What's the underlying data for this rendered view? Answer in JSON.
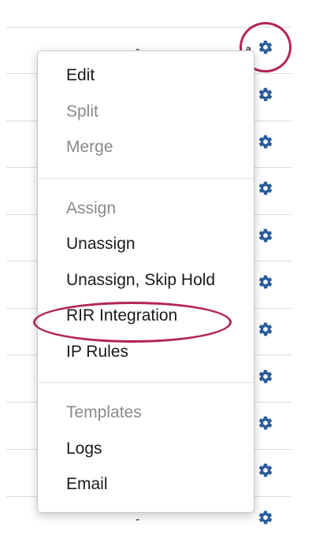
{
  "table": {
    "first_cell_value": "a",
    "empty_value": "-",
    "gear_color": "#2b5d9c",
    "gear_icon": "gear-icon"
  },
  "context_menu": {
    "groups": [
      [
        {
          "label": "Edit",
          "enabled": true
        },
        {
          "label": "Split",
          "enabled": false
        },
        {
          "label": "Merge",
          "enabled": false
        }
      ],
      [
        {
          "label": "Assign",
          "enabled": false
        },
        {
          "label": "Unassign",
          "enabled": true
        },
        {
          "label": "Unassign, Skip Hold",
          "enabled": true
        },
        {
          "label": "RIR Integration",
          "enabled": true
        },
        {
          "label": "IP Rules",
          "enabled": true
        }
      ],
      [
        {
          "label": "Templates",
          "enabled": false
        },
        {
          "label": "Logs",
          "enabled": true
        },
        {
          "label": "Email",
          "enabled": true
        }
      ]
    ]
  },
  "annotation": {
    "highlight_color": "#b3245a"
  }
}
